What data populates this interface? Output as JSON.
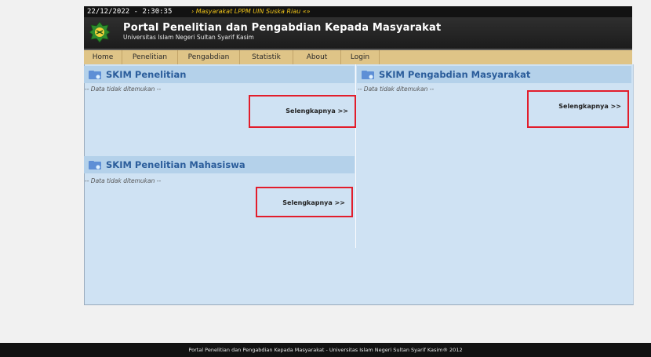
{
  "topbar": {
    "datetime": "22/12/2022 - 2:30:35",
    "marquee": "› Masyarakat LPPM UIN Suska Riau «»"
  },
  "header": {
    "title": "Portal Penelitian dan Pengabdian Kepada Masyarakat",
    "subtitle": "Universitas Islam Negeri Sultan Syarif Kasim"
  },
  "nav": {
    "items": [
      "Home",
      "Penelitian",
      "Pengabdian",
      "Statistik",
      "About",
      "Login"
    ]
  },
  "panels": {
    "penelitian": {
      "title": "SKIM Penelitian",
      "empty": "-- Data tidak ditemukan --",
      "more": "Selengkapnya >>"
    },
    "mahasiswa": {
      "title": "SKIM Penelitian Mahasiswa",
      "empty": "-- Data tidak ditemukan --",
      "more": "Selengkapnya >>"
    },
    "pengabdian": {
      "title": "SKIM Pengabdian Masyarakat",
      "empty": "-- Data tidak ditemukan --",
      "more": "Selengkapnya >>"
    }
  },
  "footer": {
    "text": "Portal Penelitian dan Pengabdian Kepada Masyarakat - Universitas Islam Negeri Sultan Syarif Kasim® 2012"
  },
  "colors": {
    "nav_bg": "#dfc487",
    "panel_head_bg": "#b4d1ea",
    "panel_title": "#2b5d9b",
    "content_bg": "#cfe2f3",
    "highlight": "#e21d2b"
  }
}
